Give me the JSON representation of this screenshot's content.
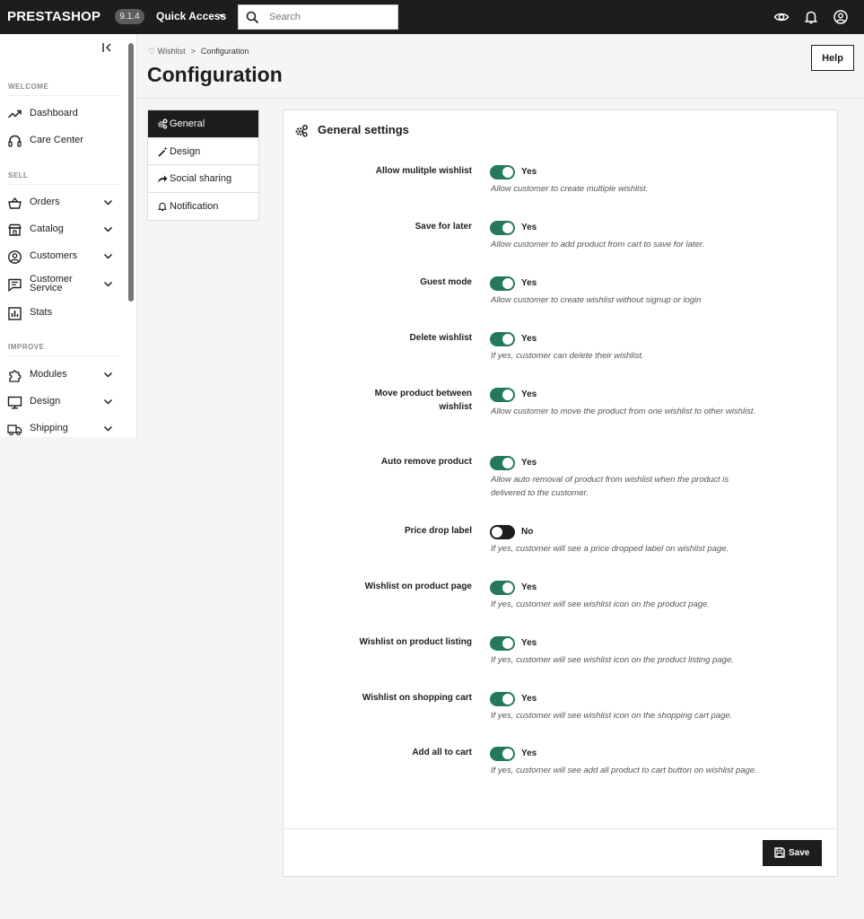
{
  "topbar": {
    "logo": "PRESTASHOP",
    "version": "9.1.4",
    "quick_access": "Quick Access",
    "search_placeholder": "Search"
  },
  "sidebar": {
    "sections": {
      "welcome": "WELCOME",
      "sell": "SELL",
      "improve": "IMPROVE"
    },
    "items": {
      "dashboard": "Dashboard",
      "care_center": "Care Center",
      "orders": "Orders",
      "catalog": "Catalog",
      "customers": "Customers",
      "customer_service_1": "Customer",
      "customer_service_2": "Service",
      "stats": "Stats",
      "modules": "Modules",
      "design": "Design",
      "shipping": "Shipping"
    }
  },
  "breadcrumb": {
    "parent": "Wishlist",
    "separator": ">",
    "current": "Configuration"
  },
  "page_title": "Configuration",
  "help_label": "Help",
  "tabs": [
    "General",
    "Design",
    "Social sharing",
    "Notification"
  ],
  "panel_title": "General settings",
  "settings": [
    {
      "label": "Allow mulitple wishlist",
      "state": "Yes",
      "desc": "Allow customer to create multiple wishlist."
    },
    {
      "label": "Save for later",
      "state": "Yes",
      "desc": "Allow customer to add product from cart to save for later."
    },
    {
      "label": "Guest mode",
      "state": "Yes",
      "desc": "Allow customer to create wishlist without signup or login"
    },
    {
      "label": "Delete wishlist",
      "state": "Yes",
      "desc": "If yes, customer can delete their wishlist."
    },
    {
      "label": "Move product between wishlist",
      "state": "Yes",
      "desc": "Allow customer to move the product from one wishlist to other wishlist."
    },
    {
      "label": "Auto remove product",
      "state": "Yes",
      "desc": "Allow auto removal of product from wishlist when the product is delivered to the customer."
    },
    {
      "label": "Price drop label",
      "state": "No",
      "desc": "If yes, customer will see a price dropped label on wishlist page."
    },
    {
      "label": "Wishlist on product page",
      "state": "Yes",
      "desc": "If yes, customer will see wishlist icon on the product page."
    },
    {
      "label": "Wishlist on product listing",
      "state": "Yes",
      "desc": "If yes, customer will see wishlist icon on the product listing page."
    },
    {
      "label": "Wishlist on shopping cart",
      "state": "Yes",
      "desc": "If yes, customer will see wishlist icon on the shopping cart page."
    },
    {
      "label": "Add all to cart",
      "state": "Yes",
      "desc": "If yes, customer will see add all product to cart button on wishlist page."
    }
  ],
  "save_label": "Save",
  "colors": {
    "topbar": "#1d1d1b",
    "switch_on": "#25795b",
    "switch_off": "#1d1d1b",
    "page_bg": "#f5f5f5"
  }
}
